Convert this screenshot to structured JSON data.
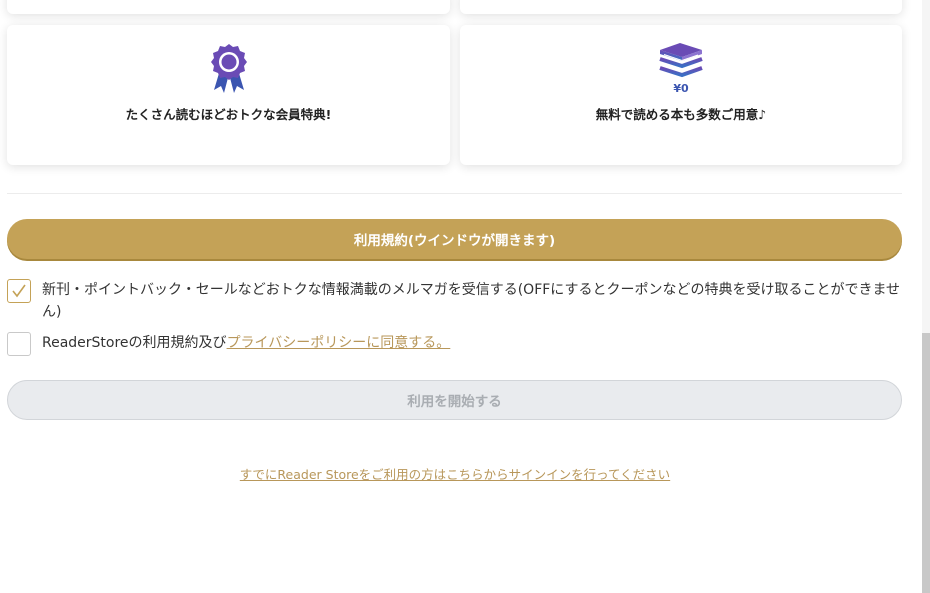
{
  "features": {
    "left": {
      "icon": "award-ribbon-icon",
      "text": "たくさん読むほどおトクな会員特典!"
    },
    "right": {
      "icon": "books-stack-icon",
      "icon_label": "¥0",
      "text": "無料で読める本も多数ご用意♪"
    }
  },
  "terms_button": {
    "label": "利用規約(ウインドウが開きます)"
  },
  "newsletter": {
    "checked": true,
    "label": "新刊・ポイントバック・セールなどおトクな情報満載のメルマガを受信する(OFFにするとクーポンなどの特典を受け取ることができません)"
  },
  "agreement": {
    "checked": false,
    "label_prefix": "ReaderStoreの利用規約及び",
    "link_text": "プライバシーポリシーに同意する。"
  },
  "start_button": {
    "label": "利用を開始する",
    "disabled": true
  },
  "signin_link": {
    "label": "すでにReader Storeをご利用の方はこちらからサインインを行ってください"
  },
  "colors": {
    "accent_gold": "#c4a257",
    "link_gold": "#b8975a",
    "award_purple": "#6a4bb5",
    "books_blue": "#3b55b0",
    "disabled_bg": "#e9ebee"
  }
}
